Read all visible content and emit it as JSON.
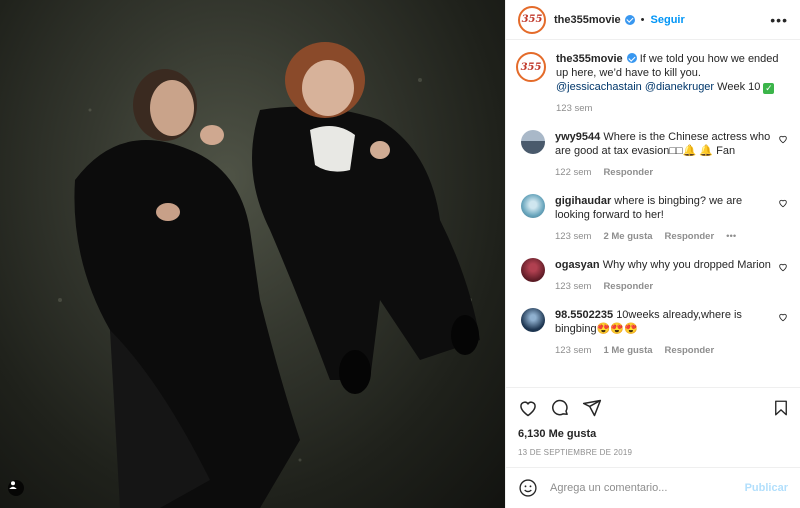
{
  "post": {
    "username": "the355movie",
    "avatar_text": "355",
    "follow_label": "Seguir",
    "more_label": "•••",
    "caption": {
      "text": "If we told you how we ended up here, we’d have to kill you.",
      "mention1": "@jessicachastain",
      "mention2": "@dianekruger",
      "tail": "Week 10",
      "check": "✓",
      "time": "123 sem"
    },
    "comments": [
      {
        "username": "ywy9544",
        "text": "Where is the Chinese actress who are good at tax evasion□□🔔 🔔 Fan",
        "time": "122 sem",
        "likes": "",
        "reply": "Responder",
        "avatar_color": "#5b6f86"
      },
      {
        "username": "gigihaudar",
        "text": "where is bingbing? we are looking forward to her!",
        "time": "123 sem",
        "likes": "2 Me gusta",
        "reply": "Responder",
        "more": "•••",
        "avatar_color": "#7fb3c8"
      },
      {
        "username": "ogasyan",
        "text": "Why why why you dropped Marion",
        "time": "123 sem",
        "likes": "",
        "reply": "Responder",
        "avatar_color": "#5a1a24"
      },
      {
        "username": "98.5502235",
        "text": "10weeks already,where is bingbing😍😍😍",
        "time": "123 sem",
        "likes": "1 Me gusta",
        "reply": "Responder",
        "avatar_color": "#1d3550"
      }
    ],
    "likes_count": "6,130 Me gusta",
    "date": "13 DE SEPTIEMBRE DE 2019",
    "add_comment_placeholder": "Agrega un comentario...",
    "publish_label": "Publicar"
  },
  "icons": {
    "like": "heart-icon",
    "comment": "comment-icon",
    "share": "share-icon",
    "save": "bookmark-icon",
    "emoji": "emoji-icon",
    "tag": "user-tag-icon"
  },
  "colors": {
    "accent": "#0095f6",
    "verified": "#3897f0",
    "muted": "#8e8e8e"
  }
}
